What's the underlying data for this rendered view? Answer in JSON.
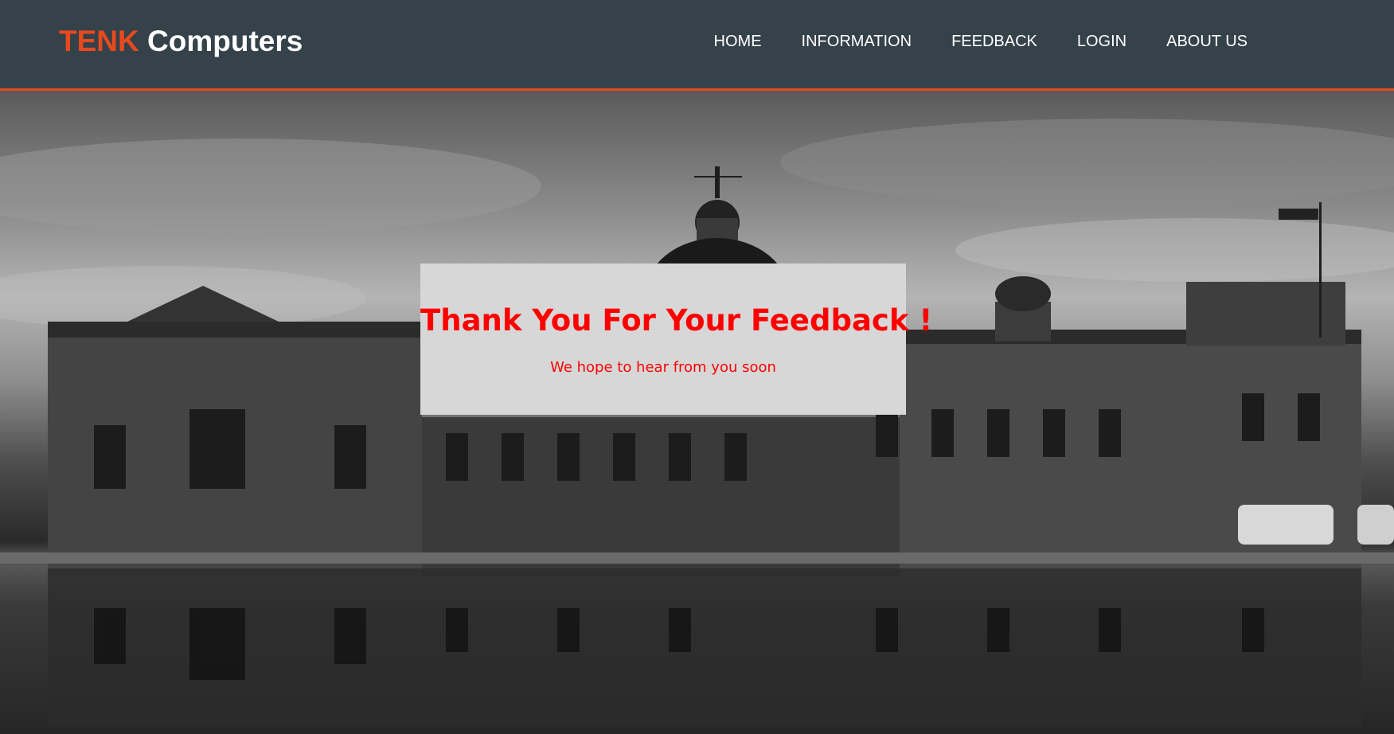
{
  "header": {
    "brand_accent": "TENK",
    "brand_rest": "Computers",
    "nav": [
      {
        "label": "HOME"
      },
      {
        "label": "INFORMATION"
      },
      {
        "label": "FEEDBACK"
      },
      {
        "label": "LOGIN"
      },
      {
        "label": "ABOUT US"
      }
    ]
  },
  "message": {
    "title": "Thank You For Your Feedback !",
    "subtitle": "We hope to hear from you soon"
  },
  "colors": {
    "header_bg": "#35424a",
    "accent": "#e8491d",
    "message_text": "#ff0000",
    "card_bg": "#d7d7d7"
  },
  "hero_image": "black-and-white photo of a historic stone building with a domed clock tower reflected in water"
}
